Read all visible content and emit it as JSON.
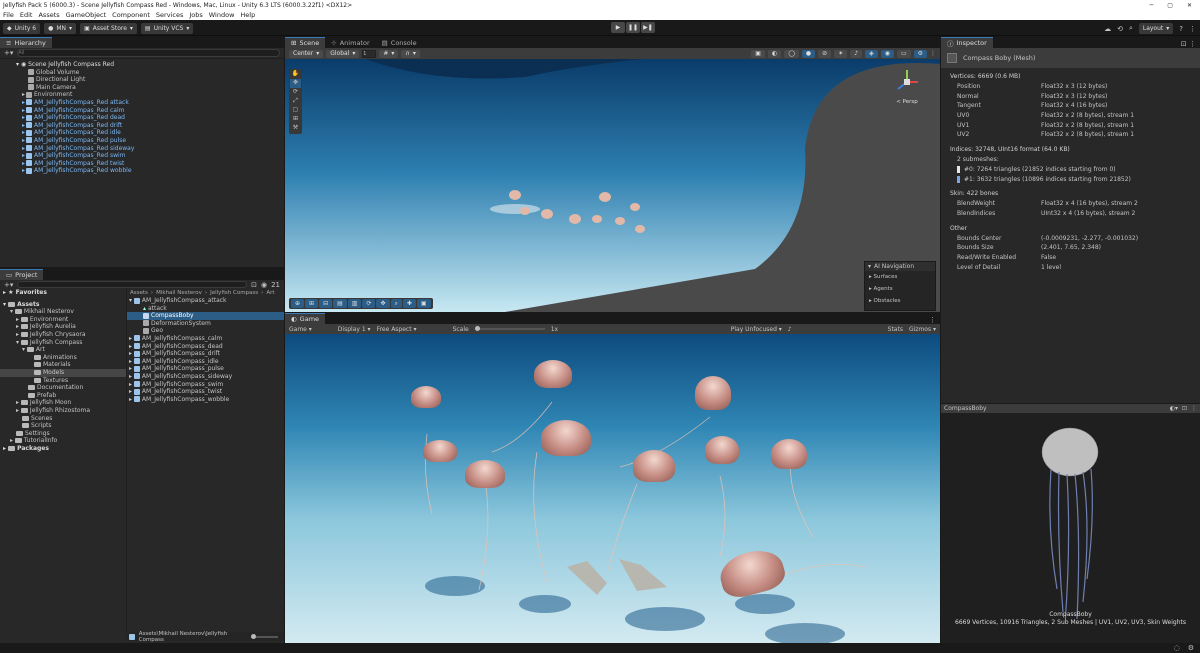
{
  "window": {
    "title": "Jellyfish Pack 5 (6000.3) - Scene Jellyfish Compass Red - Windows, Mac, Linux - Unity 6.3 LTS (6000.3.22f1) <DX12>"
  },
  "menu": [
    "File",
    "Edit",
    "Assets",
    "GameObject",
    "Component",
    "Services",
    "Jobs",
    "Window",
    "Help"
  ],
  "toolbar": {
    "unity": "Unity 6",
    "account": "MN",
    "asset_store": "Asset Store",
    "vcs": "Unity VCS",
    "layout": "Layout"
  },
  "hierarchy": {
    "tab": "Hierarchy",
    "search_placeholder": "All",
    "scene": "Scene Jellyfish Compass Red",
    "items": [
      "Global Volume",
      "Directional Light",
      "Main Camera",
      "Environment"
    ],
    "prefabs": [
      "AM_JellyfishCompas_Red attack",
      "AM_JellyfishCompas_Red calm",
      "AM_JellyfishCompas_Red dead",
      "AM_JellyfishCompas_Red drift",
      "AM_JellyfishCompas_Red idle",
      "AM_JellyfishCompas_Red pulse",
      "AM_JellyfishCompas_Red sideway",
      "AM_JellyfishCompas_Red swim",
      "AM_JellyfishCompas_Red twist",
      "AM_JellyfishCompas_Red wobble"
    ]
  },
  "project": {
    "tab": "Project",
    "badge": "21",
    "favorites": "Favorites",
    "assets": "Assets",
    "tree": [
      "Mikhail Nesterov",
      "Environment",
      "Jellyfish Aurelia",
      "Jellyfish Chrysaora",
      "Jellyfish Compass",
      "Art",
      "Animations",
      "Materials",
      "Models",
      "Textures",
      "Documentation",
      "Prefab",
      "Jellyfish Moon",
      "Jellyfish Rhizostoma",
      "Scenes",
      "Scripts",
      "Settings",
      "TutorialInfo"
    ],
    "packages": "Packages",
    "breadcrumb": [
      "Assets",
      "Mikhail Nesterov",
      "Jellyfish Compass",
      "Art"
    ],
    "files": [
      "AM_JellyfishCompass_attack",
      "attack",
      "CompassBoby",
      "DeformationSystem",
      "Geo",
      "AM_JellyfishCompass_calm",
      "AM_JellyfishCompass_dead",
      "AM_JellyfishCompass_drift",
      "AM_JellyfishCompass_idle",
      "AM_JellyfishCompass_pulse",
      "AM_JellyfishCompass_sideway",
      "AM_JellyfishCompass_swim",
      "AM_JellyfishCompass_twist",
      "AM_JellyfishCompass_wobble"
    ],
    "path": "Assets\\Mikhail Nesterov\\Jellyfish Compass"
  },
  "scene_view": {
    "tabs": [
      "Scene",
      "Animator",
      "Console"
    ],
    "pivot": "Center",
    "space": "Global",
    "snap": "1",
    "persp": "< Persp",
    "ai_nav": {
      "title": "AI Navigation",
      "items": [
        "Surfaces",
        "Agents",
        "Obstacles"
      ]
    }
  },
  "game_view": {
    "tab": "Game",
    "display_mode": "Game",
    "display": "Display 1",
    "aspect": "Free Aspect",
    "scale_label": "Scale",
    "scale_value": "1x",
    "play_mode": "Play Unfocused",
    "stats": "Stats",
    "gizmos": "Gizmos"
  },
  "inspector": {
    "tab": "Inspector",
    "object": "Compass Boby (Mesh)",
    "vertices_header": "Vertices: 6669 (0.6 MB)",
    "vertices": [
      [
        "Position",
        "Float32 x 3 (12 bytes)"
      ],
      [
        "Normal",
        "Float32 x 3 (12 bytes)"
      ],
      [
        "Tangent",
        "Float32 x 4 (16 bytes)"
      ],
      [
        "UV0",
        "Float32 x 2 (8 bytes), stream 1"
      ],
      [
        "UV1",
        "Float32 x 2 (8 bytes), stream 1"
      ],
      [
        "UV2",
        "Float32 x 2 (8 bytes), stream 1"
      ]
    ],
    "indices_header": "Indices: 32748, UInt16 format (64.0 KB)",
    "submeshes_label": "2 submeshes:",
    "submeshes": [
      "#0: 7264 triangles (21852 indices starting from 0)",
      "#1: 3632 triangles (10896 indices starting from 21852)"
    ],
    "skin_header": "Skin: 422 bones",
    "skin": [
      [
        "BlendWeight",
        "Float32 x 4 (16 bytes), stream 2"
      ],
      [
        "BlendIndices",
        "UInt32 x 4 (16 bytes), stream 2"
      ]
    ],
    "other_header": "Other",
    "other": [
      [
        "Bounds Center",
        "(-0.0009231, -2.277, -0.001032)"
      ],
      [
        "Bounds Size",
        "(2.401, 7.65, 2.348)"
      ],
      [
        "Read/Write Enabled",
        "False"
      ],
      [
        "Level of Detail",
        "1 level"
      ]
    ],
    "preview_title": "CompassBoby",
    "preview_name": "CompassBoby",
    "preview_info": "6669 Vertices, 10916 Triangles, 2 Sub Meshes | UV1, UV2, UV3, Skin Weights"
  },
  "colors": {
    "accent": "#3a79bb",
    "selection": "#2c5d87",
    "prefab_blue": "#7ab7f4",
    "panel": "#282828"
  }
}
